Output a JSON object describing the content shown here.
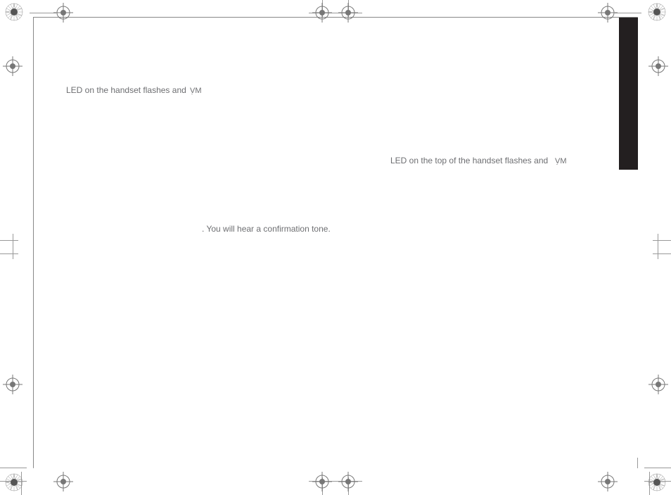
{
  "text": {
    "line1": "LED on the handset flashes and",
    "line2": "LED on the top of the handset flashes and",
    "line3": ". You will hear a confirmation tone."
  },
  "icon_label": "VM"
}
